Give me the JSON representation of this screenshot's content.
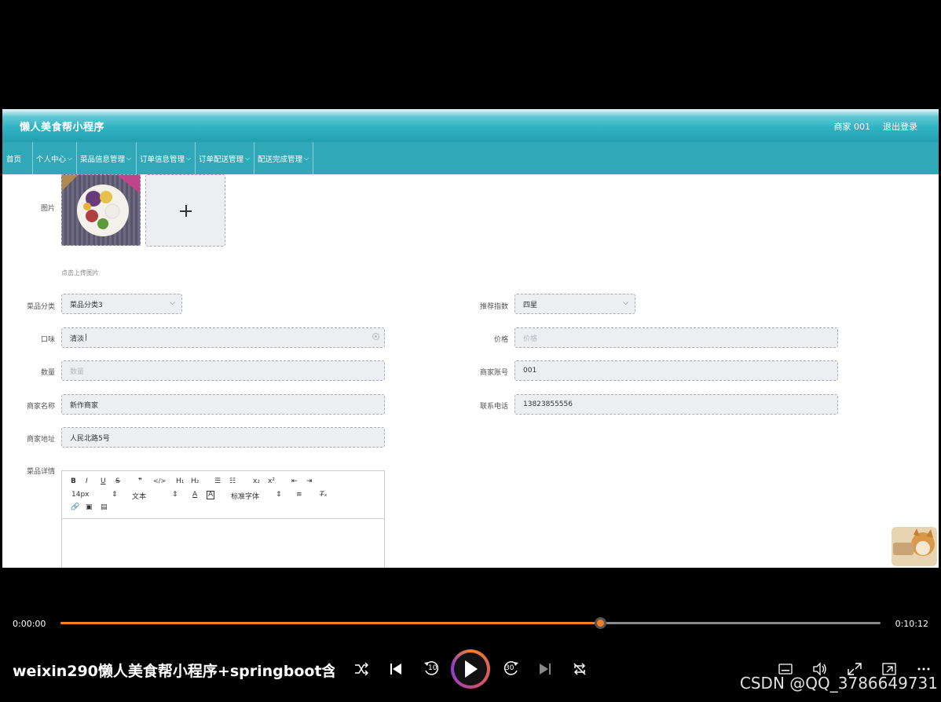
{
  "app": {
    "title": "懒人美食帮小程序",
    "user": "商家 001",
    "logout": "退出登录",
    "nav": [
      {
        "label": "首页",
        "dropdown": false
      },
      {
        "label": "个人中心",
        "dropdown": true
      },
      {
        "label": "菜品信息管理",
        "dropdown": true
      },
      {
        "label": "订单信息管理",
        "dropdown": true
      },
      {
        "label": "订单配送管理",
        "dropdown": true
      },
      {
        "label": "配送完成管理",
        "dropdown": true
      }
    ]
  },
  "form": {
    "image_label": "图片",
    "upload_hint": "点击上传图片",
    "category": {
      "label": "菜品分类",
      "value": "菜品分类3"
    },
    "recommend": {
      "label": "推荐指数",
      "value": "四星"
    },
    "taste": {
      "label": "口味",
      "value": "清淡"
    },
    "price": {
      "label": "价格",
      "placeholder": "价格"
    },
    "quantity": {
      "label": "数量",
      "placeholder": "数量"
    },
    "merchant_account": {
      "label": "商家账号",
      "value": "001"
    },
    "merchant_name": {
      "label": "商家名称",
      "value": "新作商家"
    },
    "phone": {
      "label": "联系电话",
      "value": "13823855556"
    },
    "address": {
      "label": "商家地址",
      "value": "人民北路5号"
    },
    "detail": {
      "label": "菜品详情"
    }
  },
  "editor": {
    "bold": "B",
    "italic": "I",
    "underline": "U",
    "strike": "S",
    "quote": "❞",
    "code": "</>",
    "h1": "H₁",
    "h2": "H₂",
    "ordered_list": "☰",
    "bullet_list": "☷",
    "sub": "x₂",
    "sup": "x²",
    "outdent": "⇤",
    "indent": "⇥",
    "size": "14px",
    "text_type": "文本",
    "font_color": "A",
    "bg_color": "A",
    "font_family": "标准字体",
    "align": "≡",
    "clear": "T̶ₓ",
    "link": "🔗",
    "image": "▣",
    "video": "▤"
  },
  "player": {
    "current_time": "0:00:00",
    "total_time": "0:10:12",
    "progress": 0.658,
    "title": "weixin290懒人美食帮小程序+springboot含...",
    "rewind_label": "10",
    "forward_label": "30",
    "watermark": "CSDN @QQ_3786649731"
  }
}
